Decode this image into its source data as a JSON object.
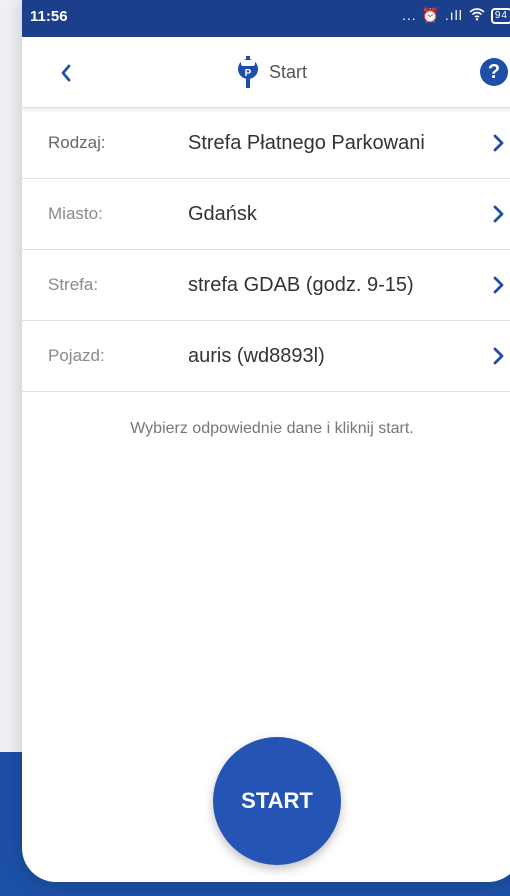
{
  "status_bar": {
    "time": "11:56",
    "indicators": "... ⏰ .ıll",
    "battery": "94"
  },
  "header": {
    "back_icon": "chevron-left-icon",
    "title_icon": "parking-meter-icon",
    "title": "Start",
    "help_label": "?"
  },
  "rows": [
    {
      "label": "Rodzaj:",
      "value": "Strefa Płatnego Parkowani"
    },
    {
      "label": "Miasto:",
      "value": "Gdańsk"
    },
    {
      "label": "Strefa:",
      "value": "strefa GDAB (godz. 9-15)"
    },
    {
      "label": "Pojazd:",
      "value": "auris (wd8893l)"
    }
  ],
  "hint": "Wybierz odpowiednie dane i kliknij start.",
  "start_button": "START",
  "colors": {
    "accent": "#1e4fa8",
    "status_bar": "#1b3f8b",
    "background_band": "#1c4fa6"
  }
}
